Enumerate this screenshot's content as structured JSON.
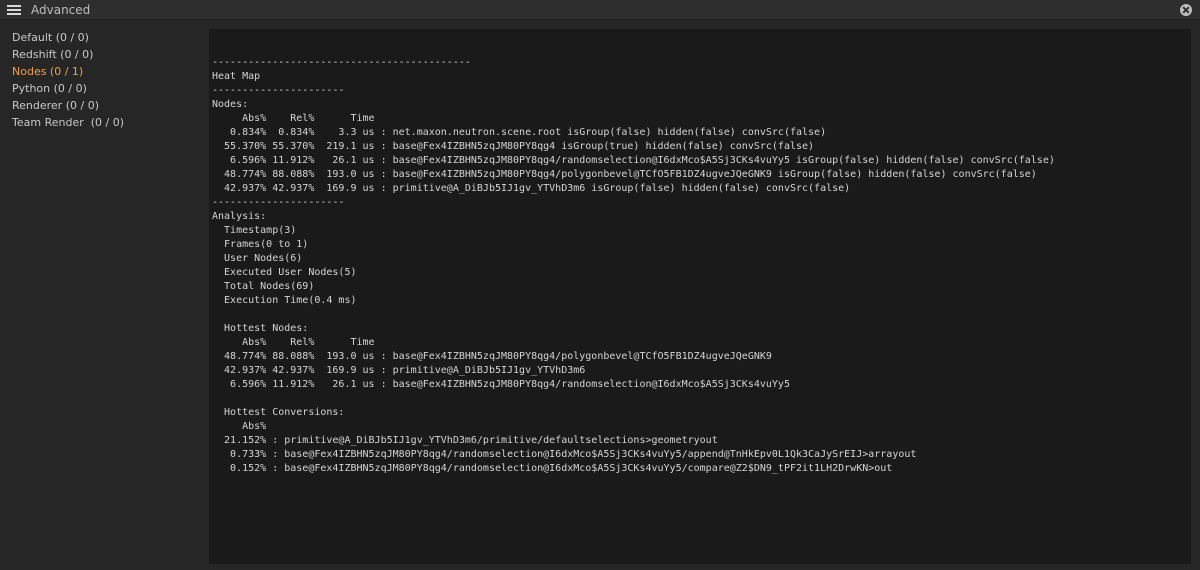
{
  "window": {
    "title": "Advanced",
    "menu_icon": "hamburger-menu-icon",
    "close_icon": "close-icon"
  },
  "sidebar": {
    "items": [
      {
        "label": "Default (0 / 0)",
        "active": false
      },
      {
        "label": "Redshift (0 / 0)",
        "active": false
      },
      {
        "label": "Nodes (0 / 1)",
        "active": true
      },
      {
        "label": "Python (0 / 0)",
        "active": false
      },
      {
        "label": "Renderer (0 / 0)",
        "active": false
      },
      {
        "label": "Team Render  (0 / 0)",
        "active": false
      }
    ],
    "accent_color": "#f0a040"
  },
  "console": {
    "lines": [
      "-------------------------------------------",
      "Heat Map",
      "----------------------",
      "Nodes:",
      "     Abs%    Rel%      Time",
      "   0.834%  0.834%    3.3 us : net.maxon.neutron.scene.root isGroup(false) hidden(false) convSrc(false)",
      "  55.370% 55.370%  219.1 us : base@Fex4IZBHN5zqJM80PY8qg4 isGroup(true) hidden(false) convSrc(false)",
      "   6.596% 11.912%   26.1 us : base@Fex4IZBHN5zqJM80PY8qg4/randomselection@I6dxMco$A5Sj3CKs4vuYy5 isGroup(false) hidden(false) convSrc(false)",
      "  48.774% 88.088%  193.0 us : base@Fex4IZBHN5zqJM80PY8qg4/polygonbevel@TCfO5FB1DZ4ugveJQeGNK9 isGroup(false) hidden(false) convSrc(false)",
      "  42.937% 42.937%  169.9 us : primitive@A_DiBJb5IJ1gv_YTVhD3m6 isGroup(false) hidden(false) convSrc(false)",
      "----------------------",
      "Analysis:",
      "  Timestamp(3)",
      "  Frames(0 to 1)",
      "  User Nodes(6)",
      "  Executed User Nodes(5)",
      "  Total Nodes(69)",
      "  Execution Time(0.4 ms)",
      "",
      "  Hottest Nodes:",
      "     Abs%    Rel%      Time",
      "  48.774% 88.088%  193.0 us : base@Fex4IZBHN5zqJM80PY8qg4/polygonbevel@TCfO5FB1DZ4ugveJQeGNK9",
      "  42.937% 42.937%  169.9 us : primitive@A_DiBJb5IJ1gv_YTVhD3m6",
      "   6.596% 11.912%   26.1 us : base@Fex4IZBHN5zqJM80PY8qg4/randomselection@I6dxMco$A5Sj3CKs4vuYy5",
      "",
      "  Hottest Conversions:",
      "     Abs%",
      "  21.152% : primitive@A_DiBJb5IJ1gv_YTVhD3m6/primitive/defaultselections>geometryout",
      "   0.733% : base@Fex4IZBHN5zqJM80PY8qg4/randomselection@I6dxMco$A5Sj3CKs4vuYy5/append@TnHkEpv0L1Qk3CaJySrEIJ>arrayout",
      "   0.152% : base@Fex4IZBHN5zqJM80PY8qg4/randomselection@I6dxMco$A5Sj3CKs4vuYy5/compare@Z2$DN9_tPF2it1LH2DrwKN>out"
    ]
  }
}
